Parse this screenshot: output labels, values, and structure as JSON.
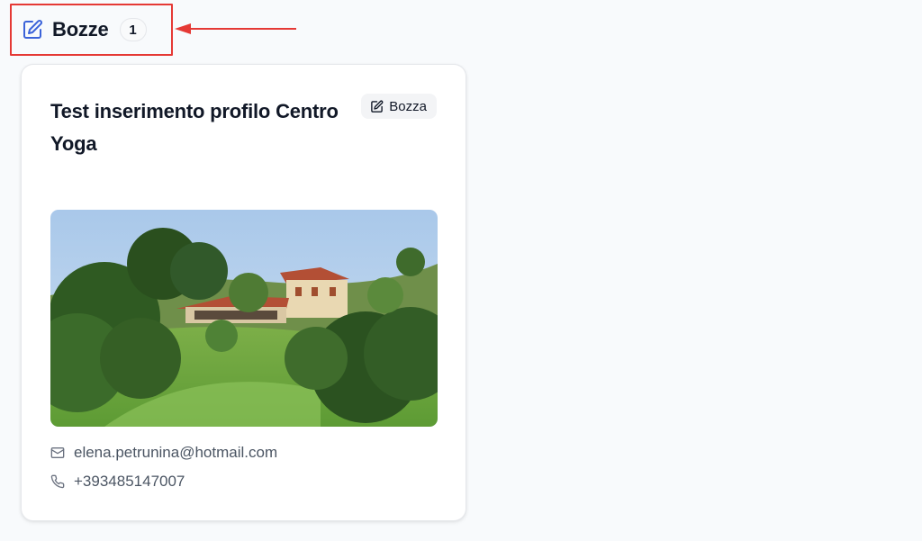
{
  "section": {
    "title": "Bozze",
    "count": "1",
    "icon": "edit-icon",
    "accent_color": "#3b63d9"
  },
  "annotation": {
    "color": "#e53935"
  },
  "card": {
    "title": "Test inserimento profilo Centro Yoga",
    "status_label": "Bozza",
    "status_icon": "edit-icon",
    "image_icon": "landscape-photo",
    "email": "elena.petrunina@hotmail.com",
    "email_icon": "mail-icon",
    "phone": "+393485147007",
    "phone_icon": "phone-icon"
  }
}
